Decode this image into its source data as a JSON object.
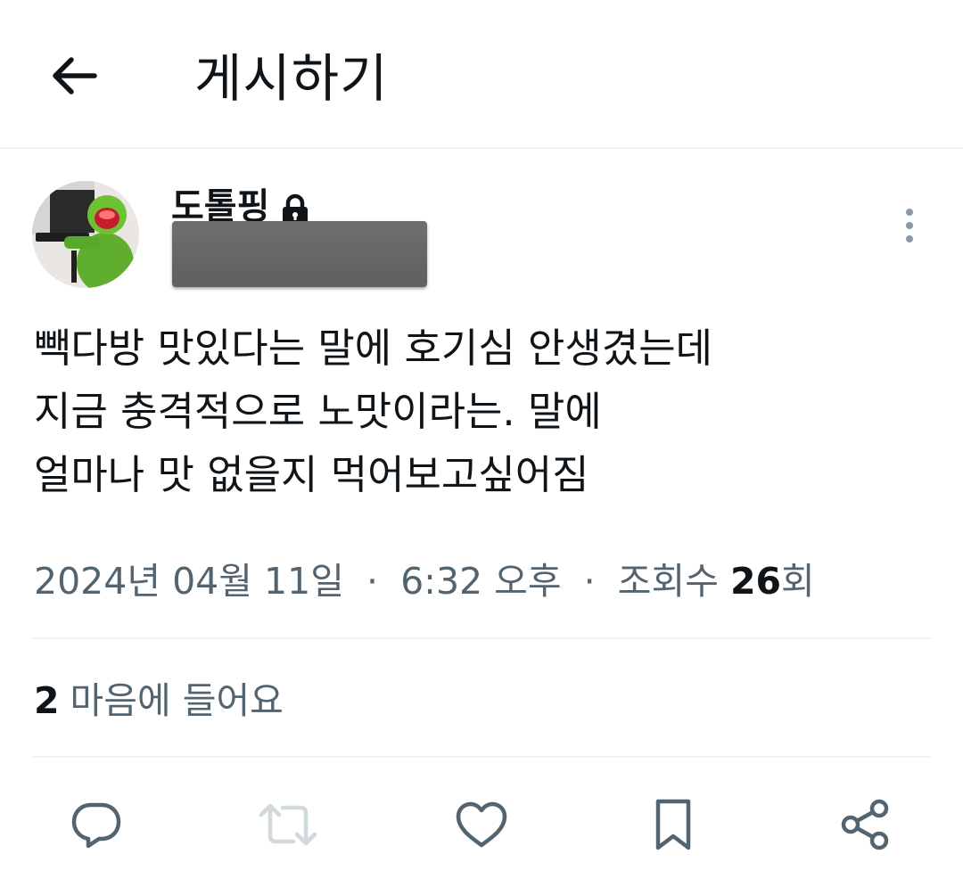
{
  "header": {
    "back_icon": "arrow-left-icon",
    "title": "게시하기"
  },
  "author": {
    "name": "도톨핑",
    "protected_icon": "lock-icon",
    "avatar": "avatar-image",
    "more_icon": "more-vertical-icon"
  },
  "post": {
    "lines": [
      "빽다방 맛있다는 말에 호기심 안생겼는데",
      "지금 충격적으로 노맛이라는. 말에",
      "얼마나 맛 없을지 먹어보고싶어짐"
    ]
  },
  "meta": {
    "date": "2024년 04월 11일",
    "separator": "·",
    "time": "6:32 오후",
    "views_label": "조회수",
    "views_count": "26",
    "views_suffix": "회"
  },
  "likes": {
    "count": "2",
    "label": "마음에 들어요"
  },
  "actions": {
    "reply_icon": "reply-icon",
    "retweet_icon": "retweet-icon",
    "like_icon": "heart-icon",
    "bookmark_icon": "bookmark-icon",
    "share_icon": "share-icon"
  },
  "colors": {
    "text_primary": "#0f1419",
    "text_secondary": "#536471",
    "icon": "#536471",
    "icon_disabled": "#cfd9de",
    "divider": "#eff3f4"
  }
}
